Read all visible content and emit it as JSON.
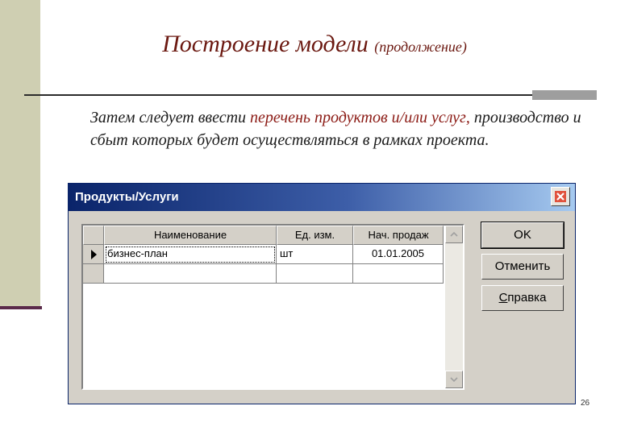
{
  "slide": {
    "title": "Построение модели",
    "title_sub": "(продолжение)",
    "para_pre": "Затем следует ввести ",
    "para_highlight": "перечень продуктов и/или услуг,",
    "para_post": " производство и сбыт которых будет осуществляться в рамках проекта.",
    "page_number": "26"
  },
  "dialog": {
    "title": "Продукты/Услуги",
    "grid": {
      "columns": [
        "Наименование",
        "Ед. изм.",
        "Нач. продаж"
      ],
      "rows": [
        {
          "name": "бизнес-план",
          "unit": "шт",
          "start": "01.01.2005"
        },
        {
          "name": "",
          "unit": "",
          "start": ""
        }
      ]
    },
    "buttons": {
      "ok": "OK",
      "cancel": "Отменить",
      "help_first": "С",
      "help_rest": "правка"
    }
  }
}
